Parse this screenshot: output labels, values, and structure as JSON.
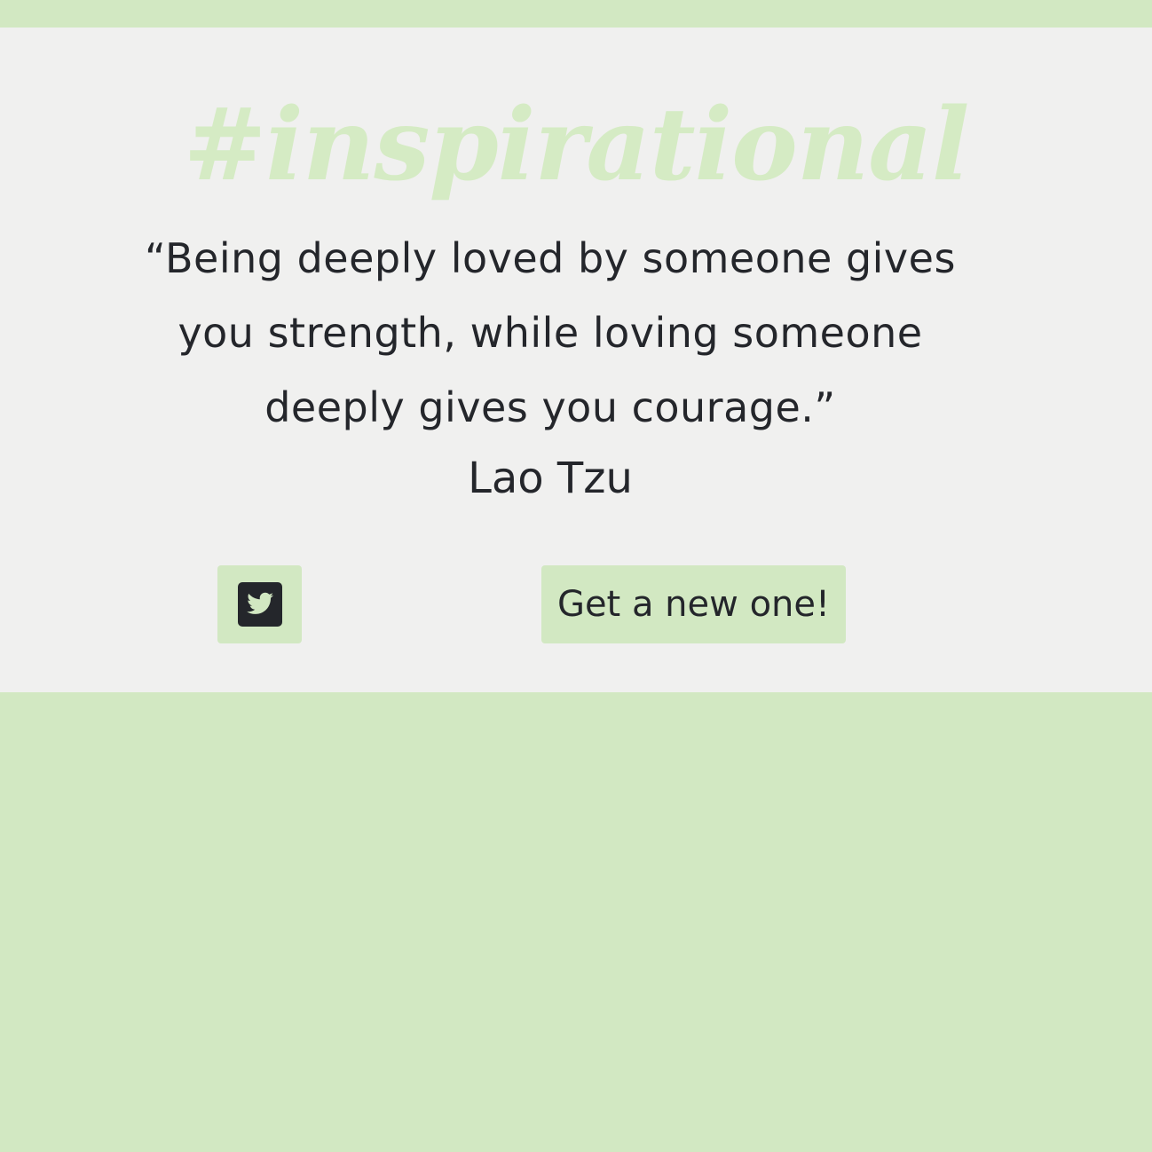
{
  "header": {
    "hashtag": "#inspirational"
  },
  "quote": {
    "text": "“Being deeply loved by someone gives you strength, while loving someone deeply gives you courage.”",
    "author": "Lao Tzu"
  },
  "actions": {
    "tweet_icon": "twitter-square-icon",
    "new_quote_label": "Get a new one!"
  },
  "colors": {
    "background": "#d2e8c2",
    "card": "#f0f0ef",
    "hashtag": "#d5ebc4",
    "text": "#24262b"
  }
}
